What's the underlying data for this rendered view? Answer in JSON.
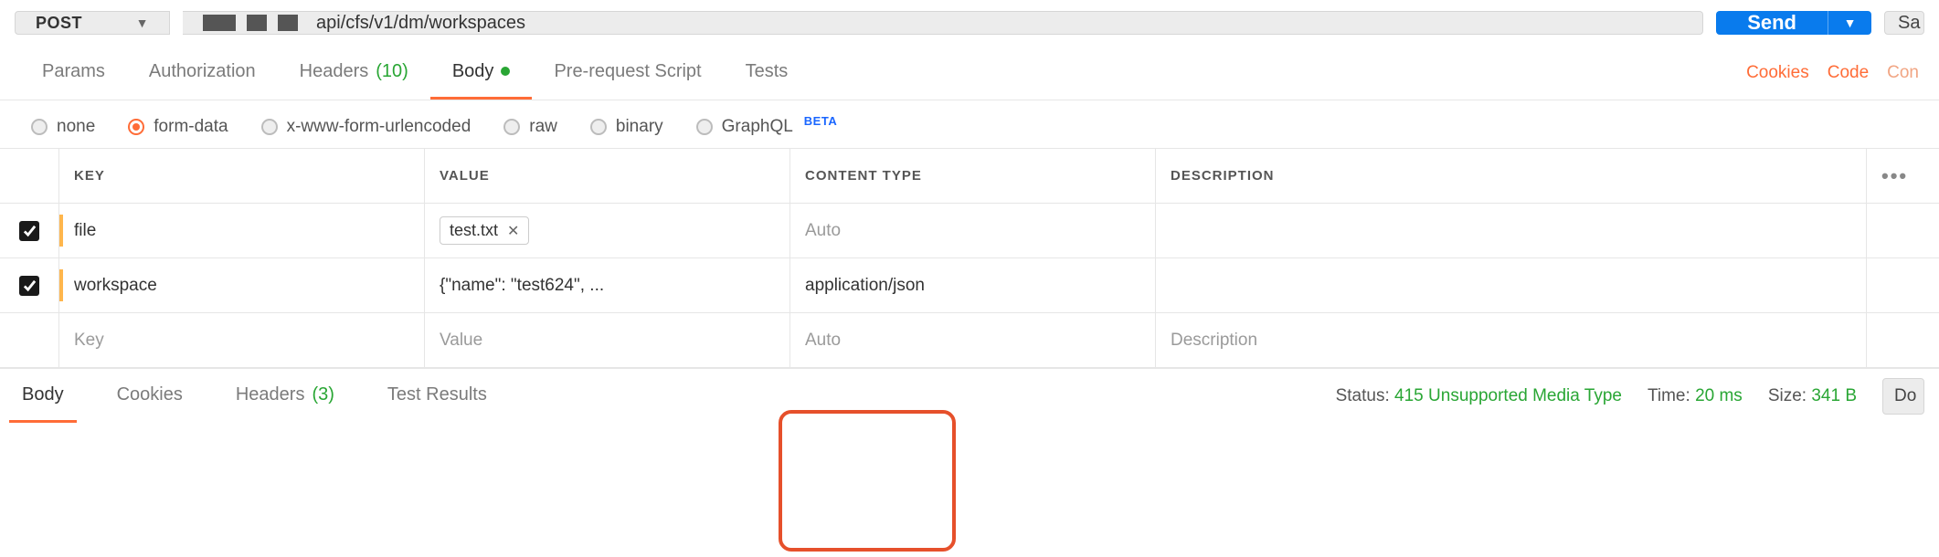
{
  "request": {
    "method": "POST",
    "url_visible": "api/cfs/v1/dm/workspaces",
    "send_label": "Send",
    "save_label": "Sa"
  },
  "req_tabs": {
    "params": "Params",
    "auth": "Authorization",
    "headers": "Headers",
    "headers_count": "(10)",
    "body": "Body",
    "prerequest": "Pre-request Script",
    "tests": "Tests",
    "right_cookies": "Cookies",
    "right_code": "Code",
    "right_comments": "Con"
  },
  "body_types": {
    "none": "none",
    "form_data": "form-data",
    "urlencoded": "x-www-form-urlencoded",
    "raw": "raw",
    "binary": "binary",
    "graphql": "GraphQL",
    "graphql_badge": "BETA"
  },
  "form_data_table": {
    "headers": {
      "key": "KEY",
      "value": "VALUE",
      "content_type": "CONTENT TYPE",
      "description": "DESCRIPTION"
    },
    "rows": [
      {
        "enabled": true,
        "key": "file",
        "value_file": "test.txt",
        "content_type_placeholder": "Auto",
        "content_type": "",
        "description": ""
      },
      {
        "enabled": true,
        "key": "workspace",
        "value": "{\"name\": \"test624\", ...",
        "content_type": "application/json",
        "description": ""
      }
    ],
    "placeholders": {
      "key": "Key",
      "value": "Value",
      "content_type": "Auto",
      "description": "Description"
    }
  },
  "response": {
    "tabs": {
      "body": "Body",
      "cookies": "Cookies",
      "headers": "Headers",
      "headers_count": "(3)",
      "test_results": "Test Results"
    },
    "status_label": "Status:",
    "status_value": "415 Unsupported Media Type",
    "time_label": "Time:",
    "time_value": "20 ms",
    "size_label": "Size:",
    "size_value": "341 B",
    "download_label": "Do"
  }
}
